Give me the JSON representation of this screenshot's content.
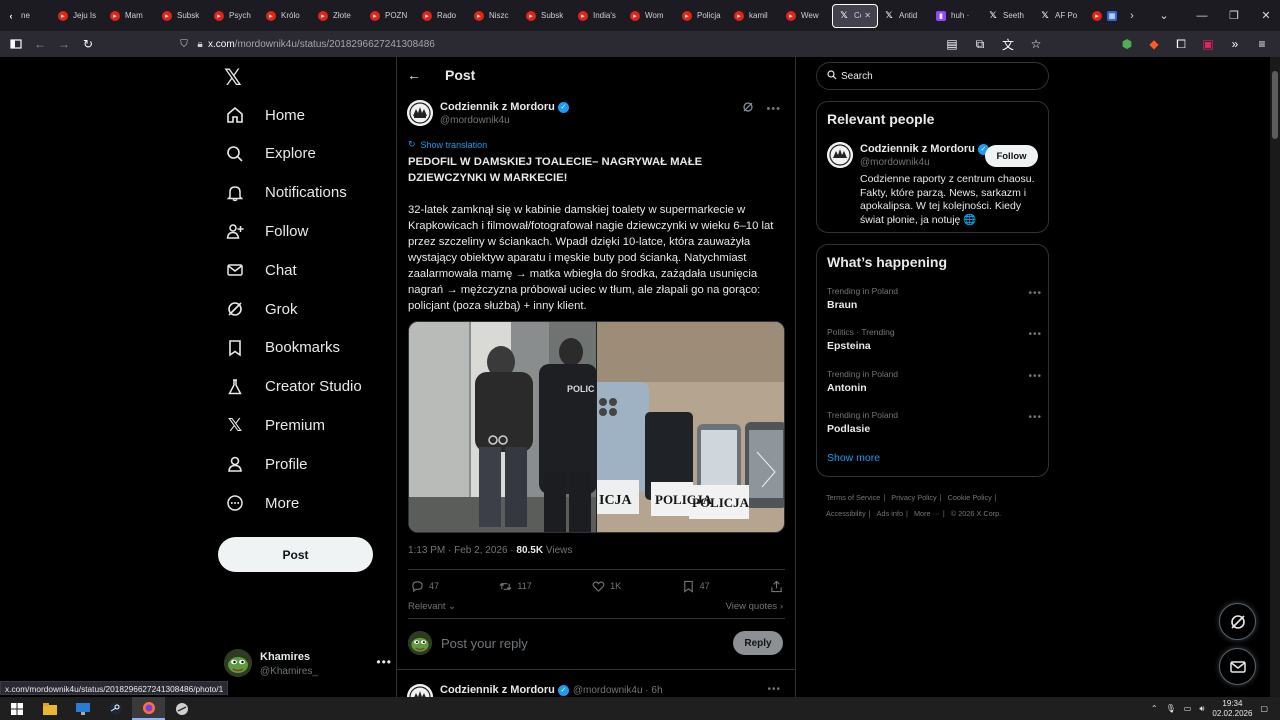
{
  "browser": {
    "tabs": [
      {
        "label": "ne",
        "icon": "back-arrow-icon"
      },
      {
        "label": "Jeju Is",
        "icon": "youtube-icon"
      },
      {
        "label": "Mam",
        "icon": "youtube-icon"
      },
      {
        "label": "Subsk",
        "icon": "youtube-icon"
      },
      {
        "label": "Psych",
        "icon": "youtube-icon"
      },
      {
        "label": "Królo",
        "icon": "youtube-icon"
      },
      {
        "label": "Złote",
        "icon": "youtube-icon"
      },
      {
        "label": "POZN",
        "icon": "youtube-icon"
      },
      {
        "label": "Rado",
        "icon": "youtube-icon"
      },
      {
        "label": "Niszc",
        "icon": "youtube-icon"
      },
      {
        "label": "Subsk",
        "icon": "youtube-icon"
      },
      {
        "label": "India's",
        "icon": "youtube-icon"
      },
      {
        "label": "Wom",
        "icon": "youtube-icon"
      },
      {
        "label": "Policja",
        "icon": "youtube-icon"
      },
      {
        "label": "kamil",
        "icon": "youtube-icon"
      },
      {
        "label": "Wew",
        "icon": "youtube-icon"
      },
      {
        "label": "Co",
        "icon": "x-icon",
        "active": true
      },
      {
        "label": "Antid",
        "icon": "x-icon"
      },
      {
        "label": "huh ·",
        "icon": "twitch-icon"
      },
      {
        "label": "Seeth",
        "icon": "x-icon"
      },
      {
        "label": "AF Po",
        "icon": "x-icon"
      }
    ],
    "url_host": "x.com",
    "url_path": "/mordownik4u/status/2018296627241308486",
    "status_url": "x.com/mordownik4u/status/2018296627241308486/photo/1"
  },
  "nav": {
    "items": [
      {
        "label": "Home",
        "icon": "home-icon"
      },
      {
        "label": "Explore",
        "icon": "search-icon"
      },
      {
        "label": "Notifications",
        "icon": "bell-icon"
      },
      {
        "label": "Follow",
        "icon": "person-plus-icon"
      },
      {
        "label": "Chat",
        "icon": "mail-icon"
      },
      {
        "label": "Grok",
        "icon": "grok-icon"
      },
      {
        "label": "Bookmarks",
        "icon": "bookmark-icon"
      },
      {
        "label": "Creator Studio",
        "icon": "flask-icon"
      },
      {
        "label": "Premium",
        "icon": "x-icon"
      },
      {
        "label": "Profile",
        "icon": "profile-icon"
      },
      {
        "label": "More",
        "icon": "more-circle-icon"
      }
    ],
    "post_button": "Post",
    "account_name": "Khamires",
    "account_handle": "@Khamires_"
  },
  "post": {
    "header_title": "Post",
    "author_name": "Codziennik z Mordoru",
    "author_handle": "@mordownik4u",
    "show_translation": "Show translation",
    "headline": "PEDOFIL W DAMSKIEJ TOALECIE– NAGRYWAŁ MAŁE DZIEWCZYNKI W MARKECIE!",
    "body": "32-latek zamknął się w kabinie damskiej toalety w supermarkecie w Krapkowicach i filmował/fotografował nagie dziewczynki w wieku 6–10 lat przez szczeliny w ściankach. Wpadł dzięki 10-latce, która zauważyła wystający obiektyw aparatu i męskie buty pod ścianką. Natychmiast zaalarmowała mamę → matka wbiegła do środka, zażądała usunięcia nagrań → mężczyzna próbował uciec w tłum, ale złapali go na gorąco: policjant (poza służbą) + inny klient.",
    "photo_police_text": "POLICJA",
    "time": "1:13 PM · Feb 2, 2026 · ",
    "views_count": "80.5K",
    "views_label": " Views",
    "replies": "47",
    "reposts": "117",
    "likes": "1K",
    "bookmarks": "47",
    "sort_label": "Relevant",
    "view_quotes": "View quotes",
    "reply_placeholder": "Post your reply",
    "reply_button": "Reply",
    "next_reply_name": "Codziennik z Mordoru",
    "next_reply_meta": "@mordownik4u · 6h"
  },
  "sidebar": {
    "search_placeholder": "Search",
    "relevant_title": "Relevant people",
    "person_name": "Codziennik z Mordoru",
    "person_handle": "@mordownik4u",
    "follow_label": "Follow",
    "person_bio": "Codzienne raporty z centrum chaosu. Fakty, które parzą. News, sarkazm i apokalipsa. W tej kolejności. Kiedy świat płonie, ja notuję 🌐",
    "happening_title": "What’s happening",
    "trends": [
      {
        "context": "Trending in Poland",
        "name": "Braun"
      },
      {
        "context": "Politics · Trending",
        "name": "Epsteina"
      },
      {
        "context": "Trending in Poland",
        "name": "Antonin"
      },
      {
        "context": "Trending in Poland",
        "name": "Podlasie"
      }
    ],
    "show_more": "Show more",
    "footer_links": [
      "Terms of Service",
      "Privacy Policy",
      "Cookie Policy",
      "Accessibility",
      "Ads info",
      "More ···",
      "© 2026 X Corp."
    ]
  },
  "taskbar": {
    "time": "19:34",
    "date": "02.02.2026"
  },
  "colors": {
    "accent": "#1d9bf0",
    "background": "#000000",
    "border": "#2f3336",
    "muted_text": "#71767b"
  }
}
